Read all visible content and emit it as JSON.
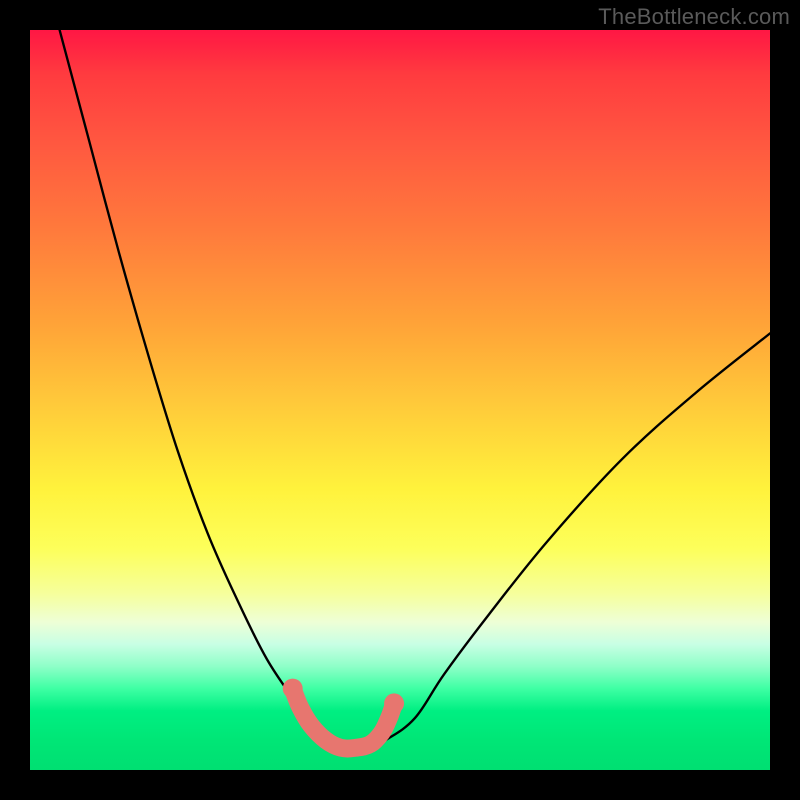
{
  "watermark": "TheBottleneck.com",
  "chart_data": {
    "type": "line",
    "title": "",
    "xlabel": "",
    "ylabel": "",
    "xlim": [
      0,
      100
    ],
    "ylim": [
      0,
      100
    ],
    "grid": false,
    "legend": false,
    "series": [
      {
        "name": "bottleneck-curve",
        "color": "#000000",
        "x": [
          4,
          8,
          12,
          16,
          20,
          24,
          28,
          32,
          36,
          38,
          40,
          42,
          44,
          46,
          48,
          52,
          56,
          62,
          70,
          80,
          90,
          100
        ],
        "y": [
          100,
          85,
          70,
          56,
          43,
          32,
          23,
          15,
          9,
          6,
          4,
          3,
          3,
          3,
          4,
          7,
          13,
          21,
          31,
          42,
          51,
          59
        ]
      },
      {
        "name": "optimal-zone-marker",
        "color": "#e7766f",
        "x": [
          35.5,
          36.5,
          38,
          40,
          42,
          44,
          46,
          47.5,
          48.5,
          49.2
        ],
        "y": [
          11,
          8.5,
          6,
          4,
          3,
          3,
          3.5,
          5,
          7,
          9
        ]
      }
    ],
    "background_gradient": {
      "top_color": "#ff1744",
      "mid_color": "#fff23c",
      "bottom_color": "#00e676",
      "meaning": "red = high bottleneck, green = low bottleneck"
    }
  }
}
